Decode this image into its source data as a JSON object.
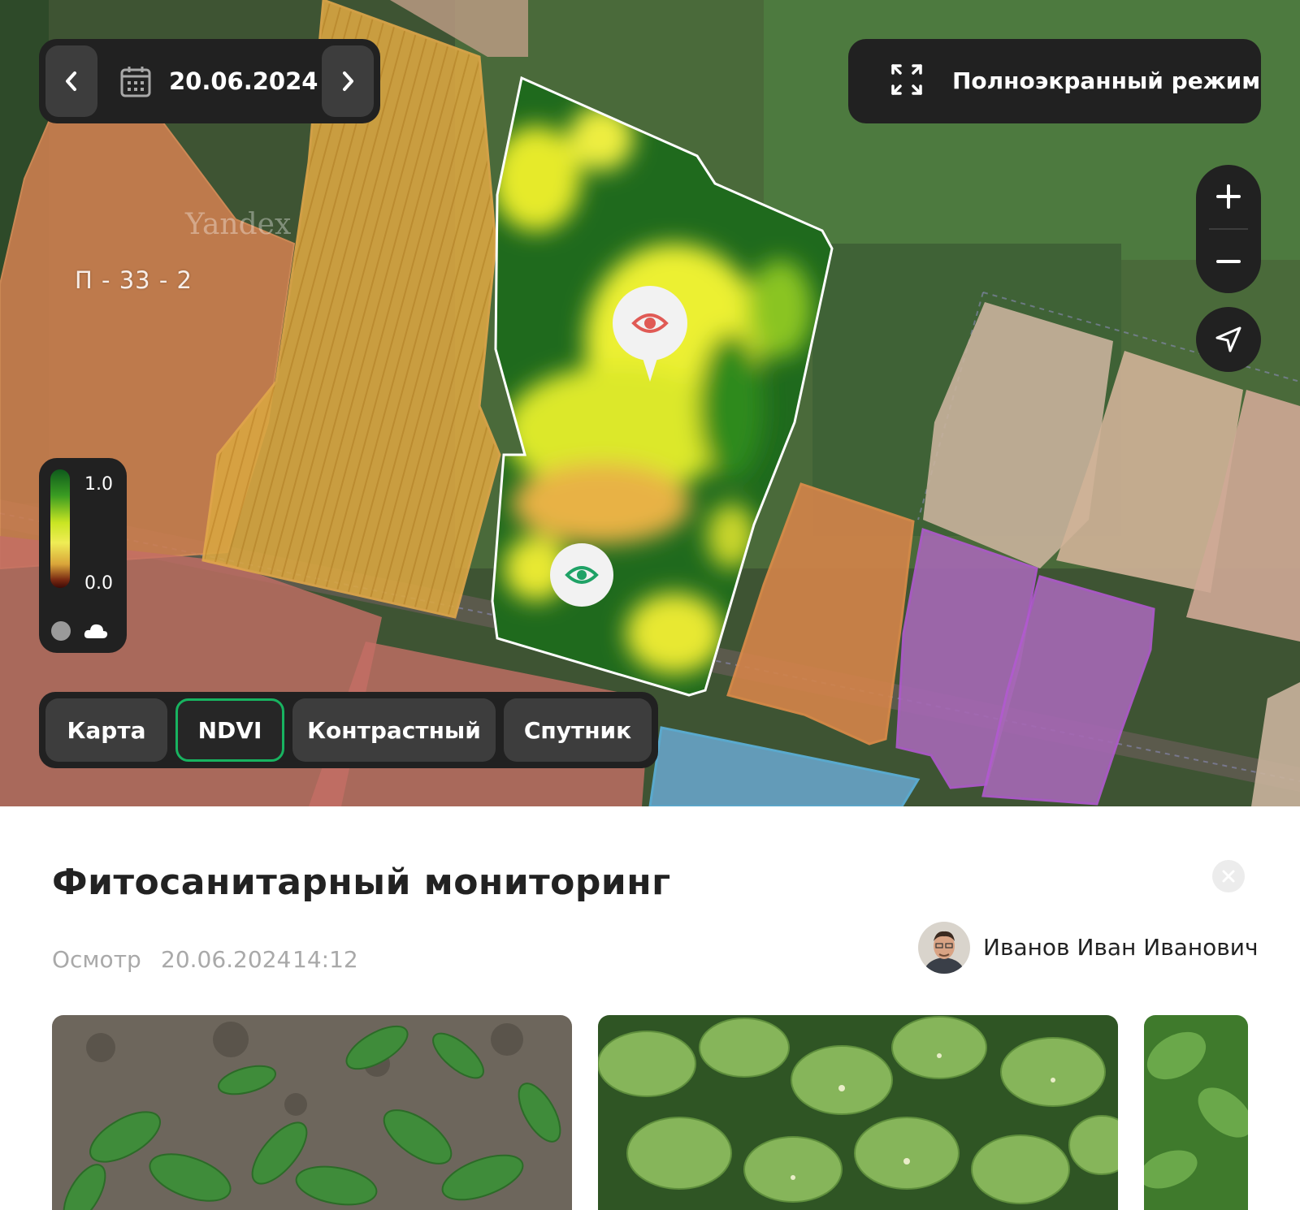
{
  "map": {
    "date": "20.06.2024",
    "fullscreen_label": "Полноэкранный режим",
    "field_label": "П - 33 - 2",
    "watermark": "Yandex",
    "legend": {
      "max": "1.0",
      "min": "0.0"
    },
    "layer_tabs": [
      {
        "label": "Карта",
        "active": false
      },
      {
        "label": "NDVI",
        "active": true
      },
      {
        "label": "Контрастный",
        "active": false
      },
      {
        "label": "Спутник",
        "active": false
      }
    ],
    "colors": {
      "control_bg": "#212121",
      "control_button": "#3d3d3d",
      "active_tab_border": "#18b360",
      "alert_pin": "#e05a55",
      "ok_pin": "#1fa266"
    }
  },
  "panel": {
    "title": "Фитосанитарный мониторинг",
    "type": "Осмотр",
    "date": "20.06.2024",
    "time": "14:12",
    "author": "Иванов Иван Иванович"
  },
  "icons": [
    "chevron-left-icon",
    "calendar-icon",
    "chevron-right-icon",
    "fullscreen-icon",
    "plus-icon",
    "minus-icon",
    "navigation-arrow-icon",
    "eye-icon",
    "cloud-icon",
    "close-icon"
  ]
}
